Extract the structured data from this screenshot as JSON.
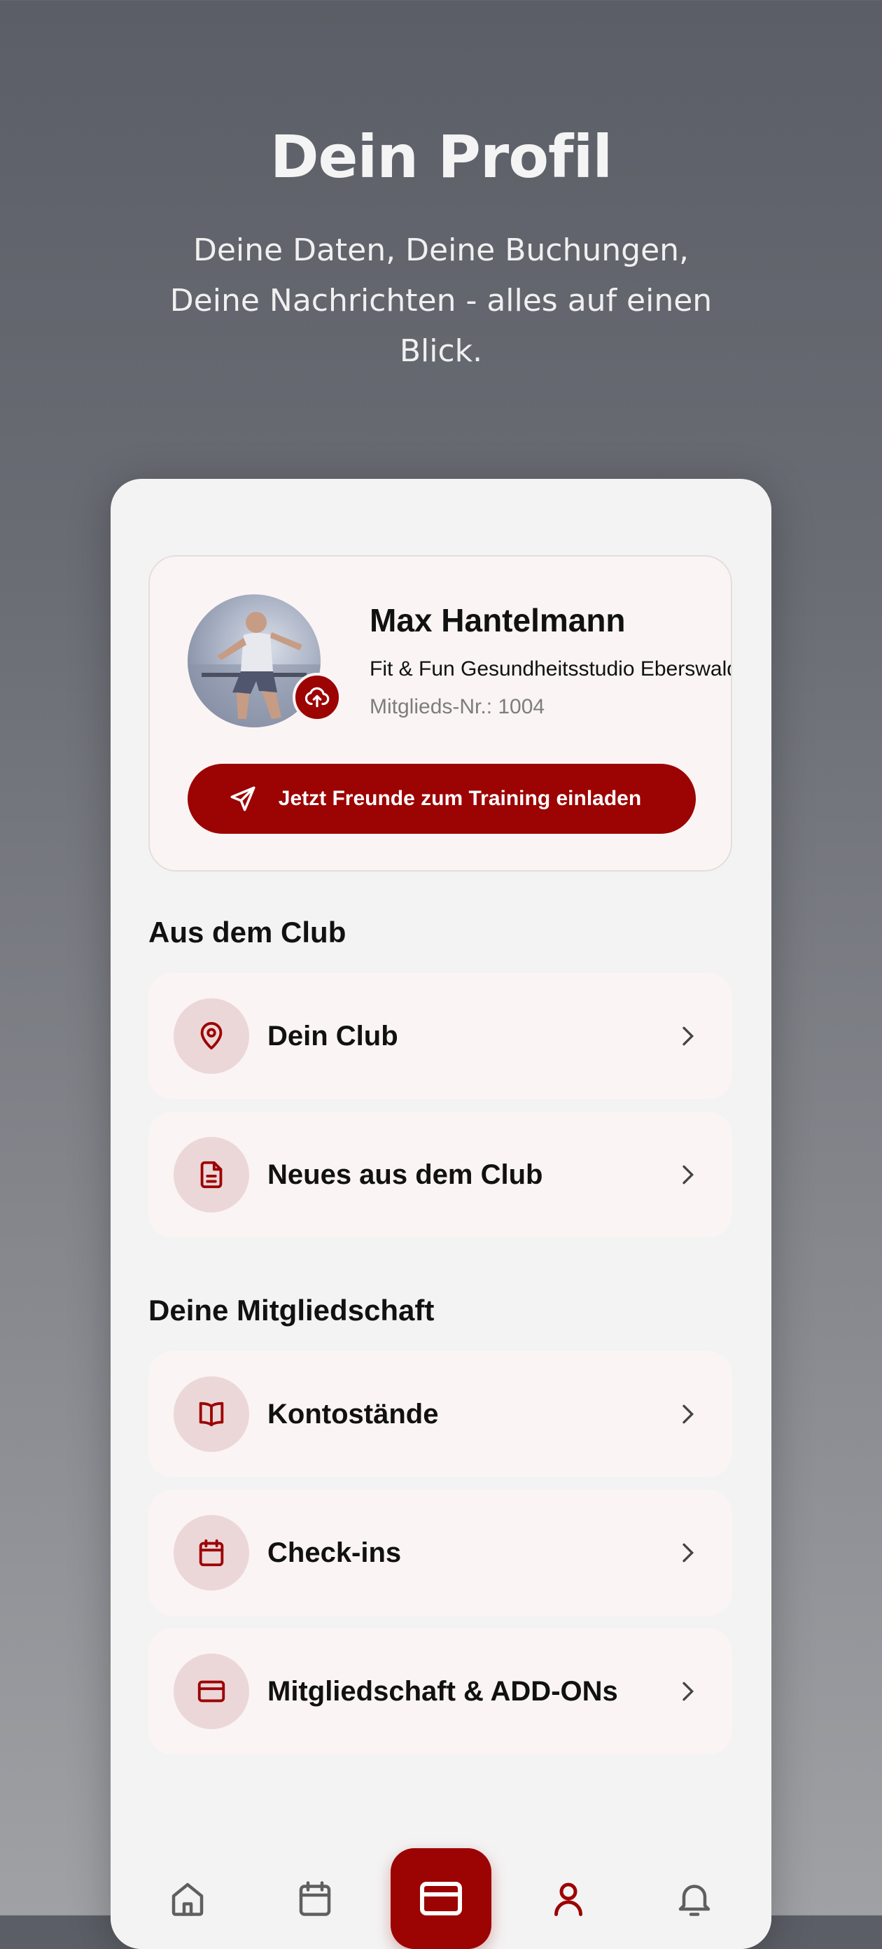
{
  "hero": {
    "title": "Dein Profil",
    "subtitle": "Deine Daten, Deine Buchungen, Deine Nachrichten - alles auf einen Blick."
  },
  "profile": {
    "name": "Max Hantelmann",
    "studio": "Fit & Fun Gesundheitsstudio Eberswalde",
    "member_number": "Mitglieds-Nr.: 1004",
    "invite_button": "Jetzt Freunde zum Training einladen"
  },
  "sections": {
    "club_title": "Aus dem Club",
    "club_items": [
      {
        "label": "Dein Club",
        "icon": "map-pin-icon"
      },
      {
        "label": "Neues aus dem Club",
        "icon": "document-icon"
      }
    ],
    "membership_title": "Deine Mitgliedschaft",
    "membership_items": [
      {
        "label": "Kontostände",
        "icon": "book-icon"
      },
      {
        "label": "Check-ins",
        "icon": "calendar-icon"
      },
      {
        "label": "Mitgliedschaft & ADD-ONs",
        "icon": "card-icon"
      }
    ]
  },
  "tabbar": {
    "items": [
      "home-icon",
      "calendar-icon",
      "card-icon",
      "user-icon",
      "bell-icon"
    ],
    "active": "user-icon"
  },
  "colors": {
    "accent": "#9c0303",
    "icon_bg": "#ecd7d8",
    "card_bg": "#fbf4f4",
    "screen_bg": "#f3f3f3"
  }
}
